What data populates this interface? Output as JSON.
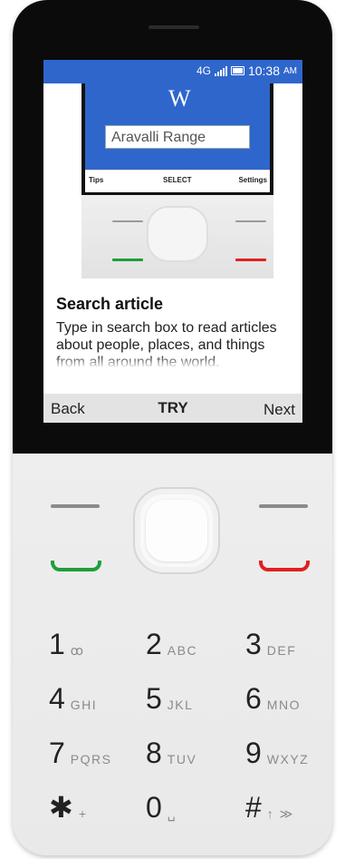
{
  "status": {
    "network": "4G",
    "time": "10:38",
    "ampm": "AM"
  },
  "preview": {
    "wiki_logo": "W",
    "search_value": "Aravalli Range",
    "softkeys": {
      "left": "Tips",
      "center": "SELECT",
      "right": "Settings"
    }
  },
  "onboarding": {
    "title": "Search article",
    "body": "Type in search box to read articles about people, places, and things from all around the world."
  },
  "softkeys": {
    "left": "Back",
    "center": "TRY",
    "right": "Next"
  },
  "keypad": [
    {
      "num": "1",
      "sub": "ꝏ"
    },
    {
      "num": "2",
      "sub": "ABC"
    },
    {
      "num": "3",
      "sub": "DEF"
    },
    {
      "num": "4",
      "sub": "GHI"
    },
    {
      "num": "5",
      "sub": "JKL"
    },
    {
      "num": "6",
      "sub": "MNO"
    },
    {
      "num": "7",
      "sub": "PQRS"
    },
    {
      "num": "8",
      "sub": "TUV"
    },
    {
      "num": "9",
      "sub": "WXYZ"
    },
    {
      "num": "✱",
      "sub": "+"
    },
    {
      "num": "0",
      "sub": "␣"
    },
    {
      "num": "#",
      "sub": "↑ ≫"
    }
  ],
  "colors": {
    "accent": "#2f66cc",
    "call": "#1f9e3a",
    "end": "#e02020"
  }
}
